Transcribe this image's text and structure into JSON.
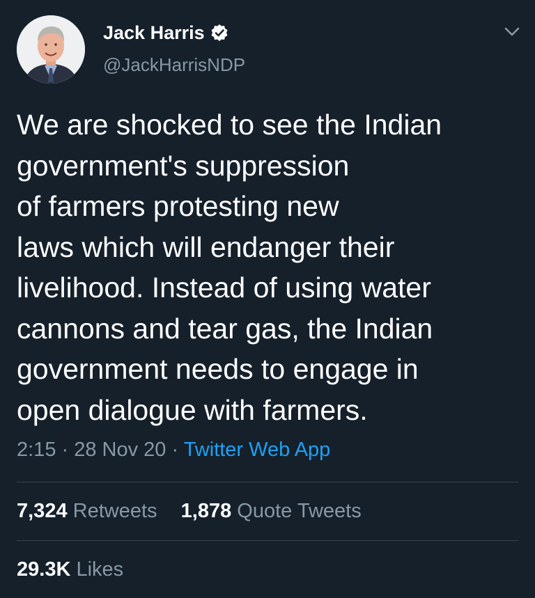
{
  "author": {
    "display_name": "Jack Harris",
    "handle": "@JackHarrisNDP",
    "verified": true,
    "avatar_icon": "profile-photo"
  },
  "tweet": {
    "text": "We are shocked to see the Indian\ngovernment's suppression\nof farmers protesting new\nlaws which will endanger their\nlivelihood. Instead of using water\ncannons and tear gas, the Indian\ngovernment needs to engage in\nopen dialogue with farmers.",
    "time": "2:15",
    "sep1": " · ",
    "date": "28 Nov 20",
    "sep2": " · ",
    "source": "Twitter Web App"
  },
  "stats": {
    "retweets_count": "7,324",
    "retweets_label": "Retweets",
    "quote_count": "1,878",
    "quote_label": "Quote Tweets",
    "likes_count": "29.3K",
    "likes_label": "Likes"
  },
  "colors": {
    "background": "#15202b",
    "secondary_text": "#8899a6",
    "link": "#1da1f2",
    "divider": "#38444d"
  },
  "icons": {
    "verified": "verified-badge-icon",
    "menu": "chevron-down-icon"
  }
}
